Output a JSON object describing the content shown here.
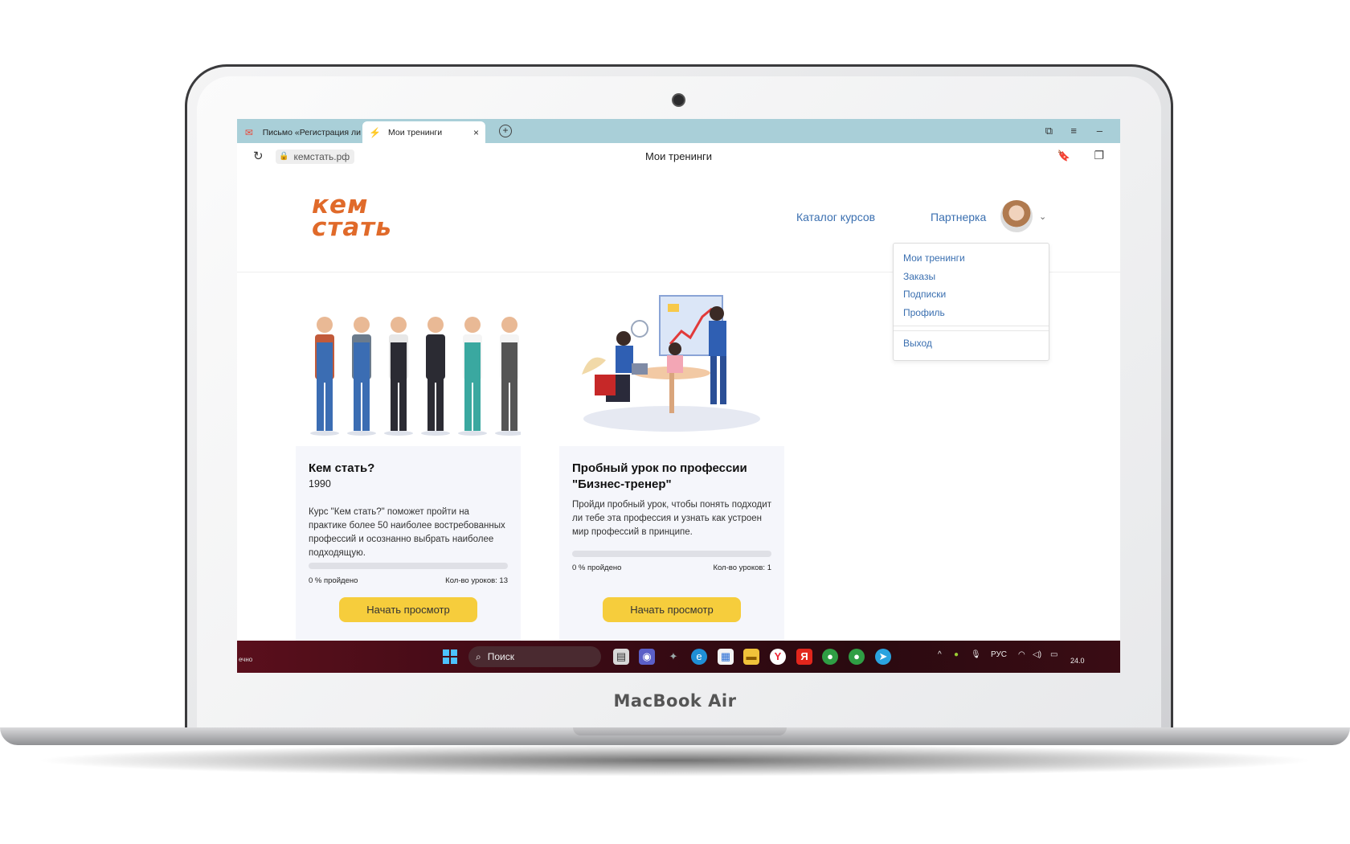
{
  "device": {
    "brand": "MacBook Air"
  },
  "browser": {
    "tabs": [
      {
        "label": "Письмо «Регистрация ли",
        "icon": "mail-icon"
      },
      {
        "label": "Мои тренинги",
        "icon": "runner-icon",
        "close": "×"
      }
    ],
    "new_tab": "+",
    "address": "кемстать.рф",
    "page_title": "Мои тренинги",
    "window_buttons": [
      "⧉",
      "≡",
      "–"
    ]
  },
  "site": {
    "logo_line1": "кем",
    "logo_line2": "стать",
    "nav": {
      "catalog": "Каталог курсов",
      "partner": "Партнерка"
    },
    "user_menu": {
      "items": [
        "Мои тренинги",
        "Заказы",
        "Подписки",
        "Профиль"
      ],
      "logout": "Выход"
    }
  },
  "courses": [
    {
      "title": "Кем стать?",
      "year": "1990",
      "description": "Курс \"Кем стать?\" поможет пройти на практике более 50 наиболее востребованных профессий и осознанно выбрать наиболее подходящую.",
      "progress_label": "0 % пройдено",
      "progress": 0,
      "lessons_label": "Кол-во уроков: 13",
      "button": "Начать просмотр"
    },
    {
      "title": "Пробный урок по профессии \"Бизнес-тренер\"",
      "description": "Пройди пробный урок, чтобы понять подходит ли тебе эта профессия и узнать как устроен мир профессий в принципе.",
      "progress_label": "0 % пройдено",
      "progress": 0,
      "lessons_label": "Кол-во уроков: 1",
      "button": "Начать просмотр"
    }
  ],
  "taskbar": {
    "left_text": "ечно",
    "search_placeholder": "Поиск",
    "lang": "РУС",
    "clock": "24.0"
  },
  "colors": {
    "accent_button": "#f6cd3c",
    "logo": "#e06a2a",
    "link": "#3a6fb0",
    "tabstrip": "#a9cfd8"
  }
}
